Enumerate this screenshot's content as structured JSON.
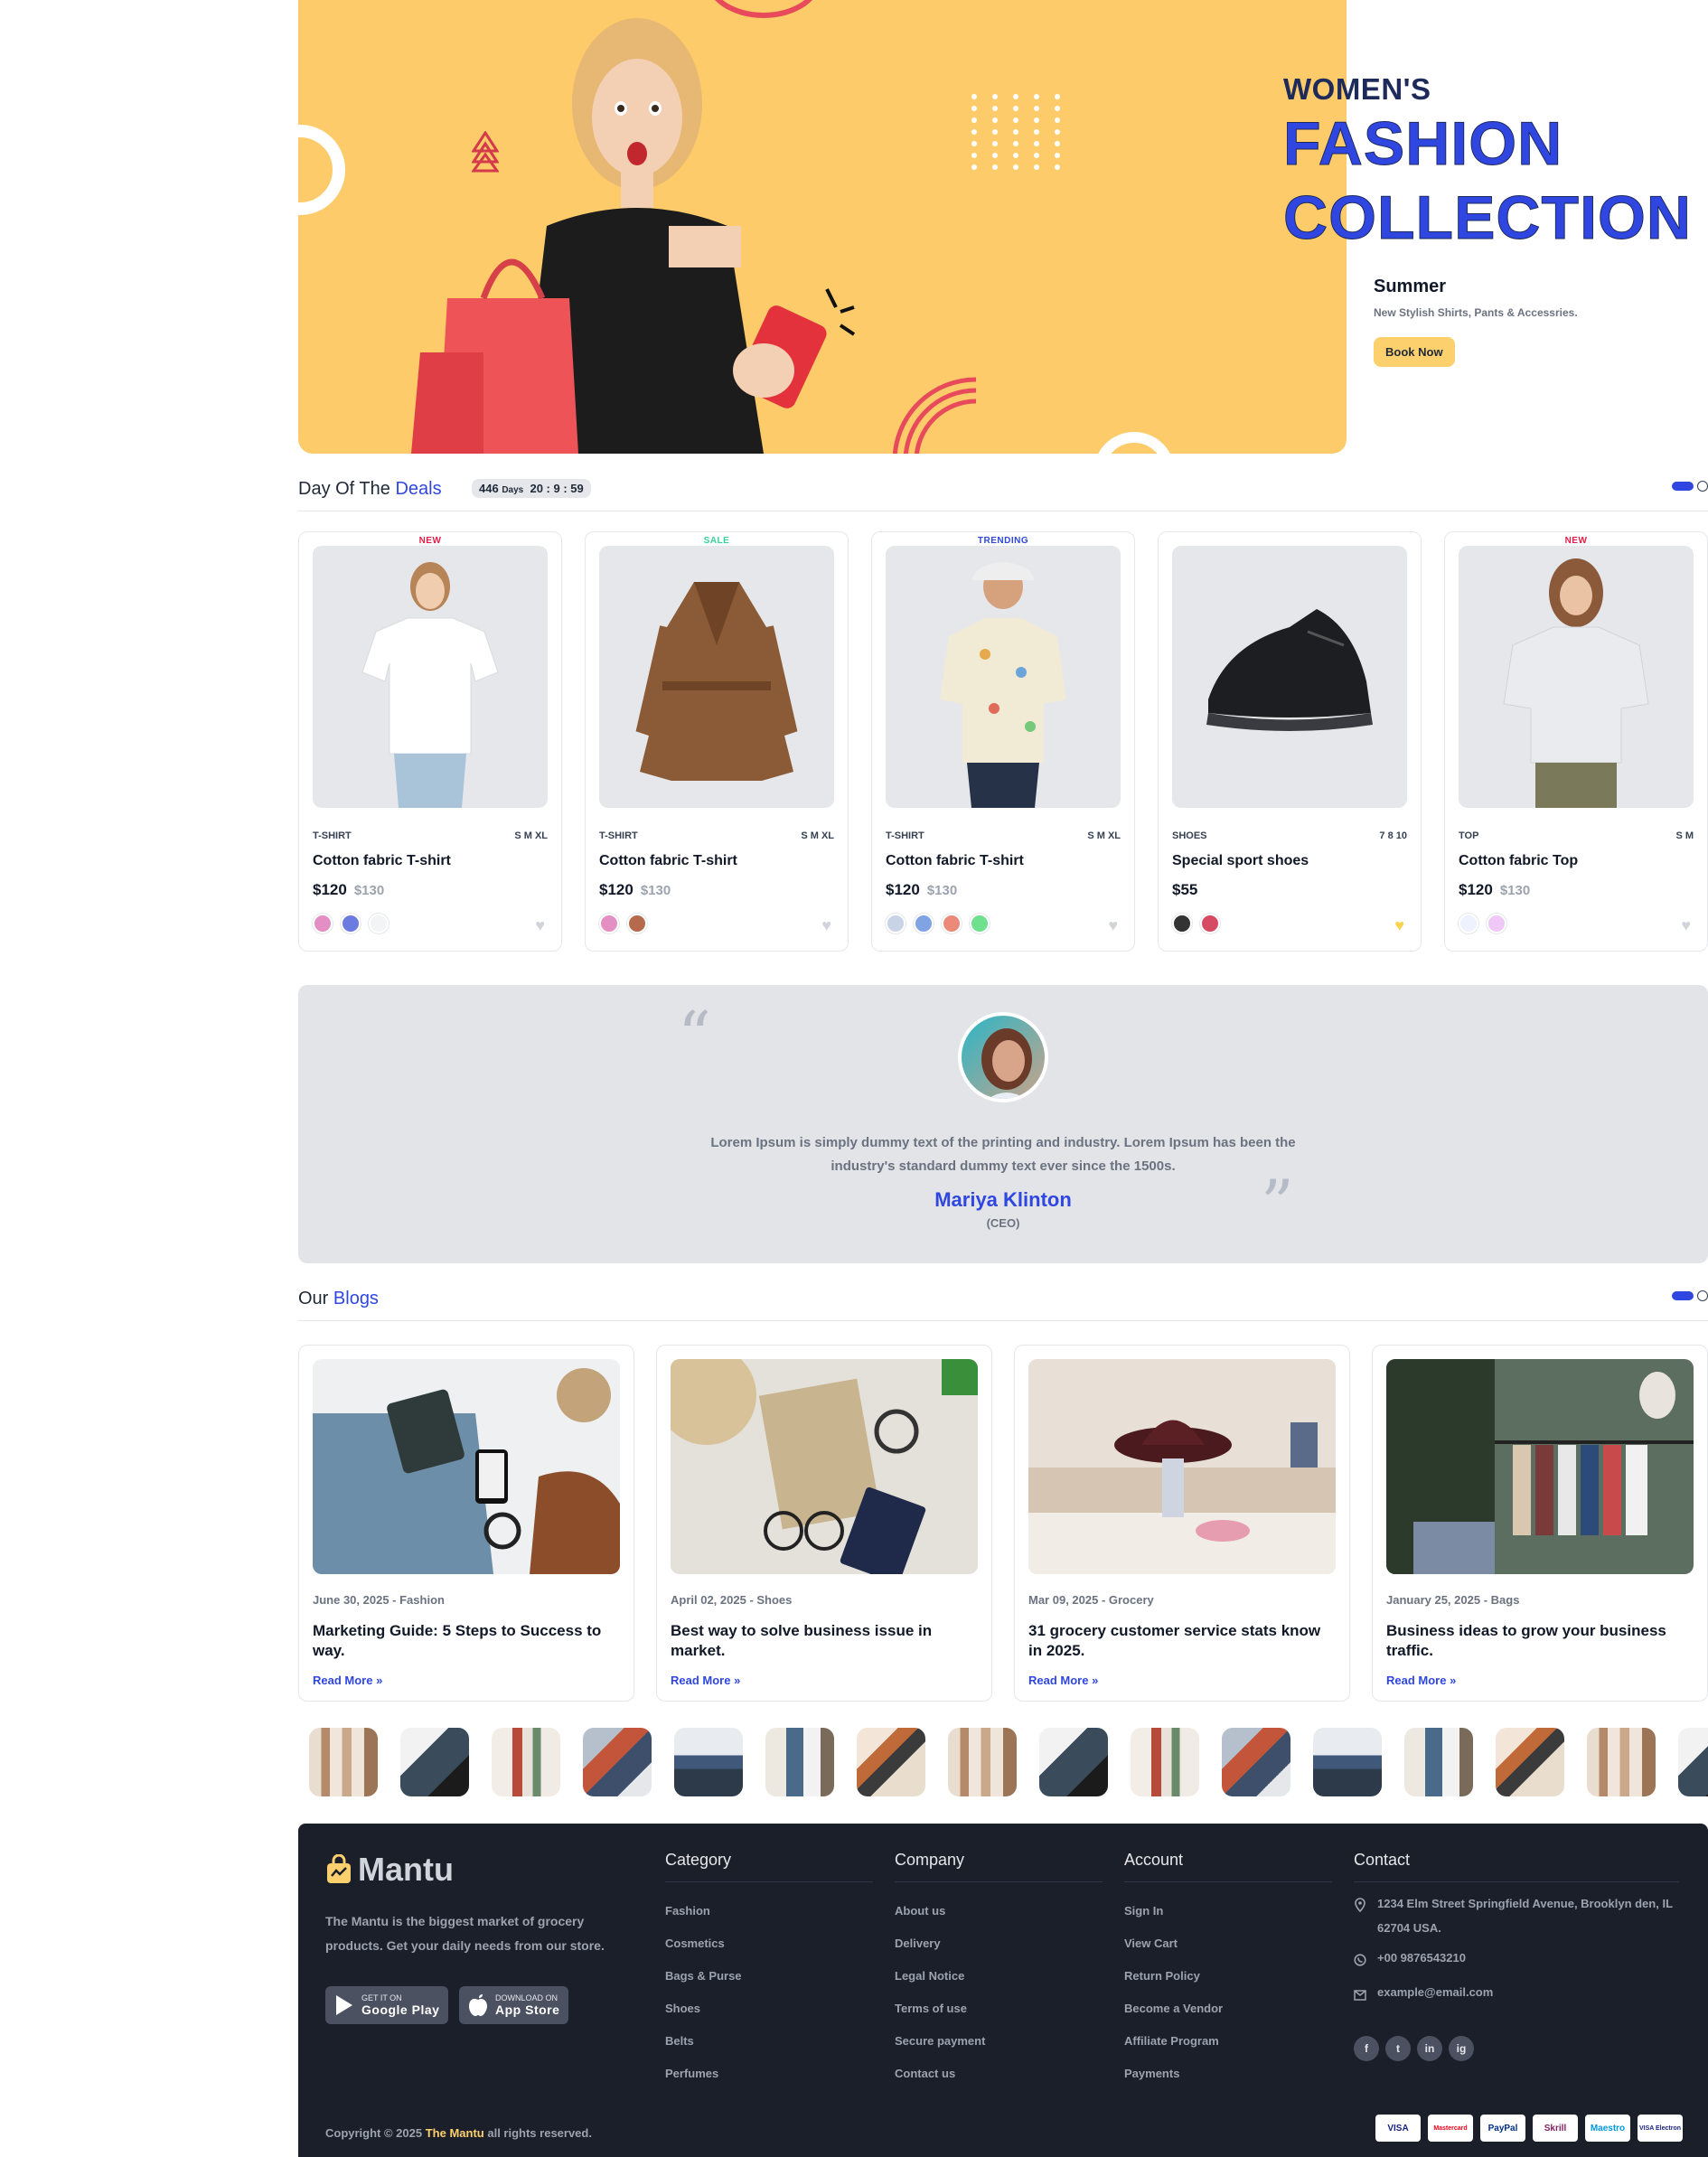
{
  "hero": {
    "kicker": "WOMEN'S",
    "title_line1": "FASHION",
    "title_line2": "COLLECTION",
    "season": "Summer",
    "description": "New Stylish Shirts, Pants & Accessries.",
    "cta": "Book Now"
  },
  "deals": {
    "title_plain": "Day Of The",
    "title_accent": "Deals",
    "timer": {
      "days": "446",
      "days_label": "Days",
      "clock": "20 : 9  : 59"
    },
    "products": [
      {
        "badge": "NEW",
        "badge_color": "#e11d48",
        "category": "T-SHIRT",
        "sizes": "S M XL",
        "name": "Cotton fabric T-shirt",
        "price": "$120",
        "old_price": "$130",
        "swatches": [
          "#e38fc4",
          "#6b7be0",
          "#f3f4f6"
        ],
        "favorite": false
      },
      {
        "badge": "SALE",
        "badge_color": "#34d399",
        "category": "T-SHIRT",
        "sizes": "S M XL",
        "name": "Cotton fabric T-shirt",
        "price": "$120",
        "old_price": "$130",
        "swatches": [
          "#e38fc4",
          "#b56a4d"
        ],
        "favorite": false
      },
      {
        "badge": "TRENDING",
        "badge_color": "#2f47e0",
        "category": "T-SHIRT",
        "sizes": "S M XL",
        "name": "Cotton fabric T-shirt",
        "price": "$120",
        "old_price": "$130",
        "swatches": [
          "#c8d3e6",
          "#7fa3e3",
          "#ec8a7a",
          "#6fe08e"
        ],
        "favorite": false
      },
      {
        "badge": "",
        "badge_color": "#ffffff",
        "category": "SHOES",
        "sizes": "7 8 10",
        "name": "Special sport shoes",
        "price": "$55",
        "old_price": "",
        "swatches": [
          "#333333",
          "#d64b63"
        ],
        "favorite": true
      },
      {
        "badge": "NEW",
        "badge_color": "#e11d48",
        "category": "TOP",
        "sizes": "S M",
        "name": "Cotton fabric Top",
        "price": "$120",
        "old_price": "$130",
        "swatches": [
          "#eef2ff",
          "#f0c8f7"
        ],
        "favorite": false
      }
    ]
  },
  "testimonial": {
    "text": "Lorem Ipsum is simply dummy text of the printing and industry. Lorem Ipsum has been the industry's standard dummy text ever since the 1500s.",
    "name": "Mariya Klinton",
    "role": "(CEO)"
  },
  "blogs": {
    "title_plain": "Our",
    "title_accent": "Blogs",
    "posts": [
      {
        "meta": "June 30, 2025 - Fashion",
        "title": "Marketing Guide: 5 Steps to Success to way.",
        "more": "Read More"
      },
      {
        "meta": "April 02, 2025 - Shoes",
        "title": "Best way to solve business issue in market.",
        "more": "Read More"
      },
      {
        "meta": "Mar 09, 2025 - Grocery",
        "title": "31 grocery customer service stats know in 2025.",
        "more": "Read More"
      },
      {
        "meta": "January 25, 2025 - Bags",
        "title": "Business ideas to grow your business traffic.",
        "more": "Read More"
      }
    ]
  },
  "footer": {
    "brand": "Mantu",
    "about": "The Mantu is the biggest market of grocery products. Get your daily needs from our store.",
    "google_play": {
      "small": "GET IT ON",
      "big": "Google Play"
    },
    "app_store": {
      "small": "DOWNLOAD ON",
      "big": "App Store"
    },
    "category": {
      "title": "Category",
      "links": [
        "Fashion",
        "Cosmetics",
        "Bags & Purse",
        "Shoes",
        "Belts",
        "Perfumes"
      ]
    },
    "company": {
      "title": "Company",
      "links": [
        "About us",
        "Delivery",
        "Legal Notice",
        "Terms of use",
        "Secure payment",
        "Contact us"
      ]
    },
    "account": {
      "title": "Account",
      "links": [
        "Sign In",
        "View Cart",
        "Return Policy",
        "Become a Vendor",
        "Affiliate Program",
        "Payments"
      ]
    },
    "contact": {
      "title": "Contact",
      "address": "1234 Elm Street Springfield Avenue, Brooklyn den, IL 62704 USA.",
      "phone": "+00 9876543210",
      "email": "example@email.com"
    },
    "social": [
      "f",
      "t",
      "in",
      "ig"
    ],
    "copyright_pre": "Copyright © 2025",
    "copyright_brand": "The Mantu",
    "copyright_post": "all rights reserved.",
    "payments": [
      "VISA",
      "Mastercard",
      "PayPal",
      "Skrill",
      "Maestro",
      "VISA Electron"
    ]
  }
}
